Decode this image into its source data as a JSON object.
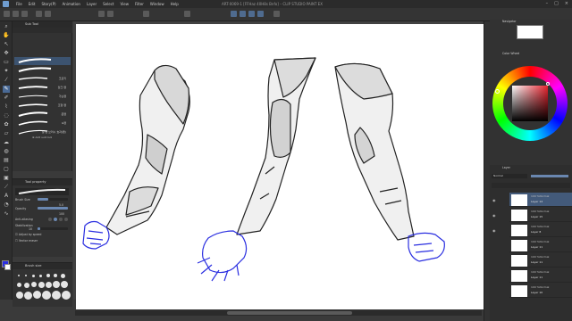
{
  "window": {
    "title": "ART-0069-1 [FFHaz 40H8s Bnfo] – CLIP STUDIO PAINT EX",
    "controls": [
      "–",
      "□",
      "×"
    ]
  },
  "menu": [
    "File",
    "Edit",
    "Story(P)",
    "Animation",
    "Layer",
    "Select",
    "View",
    "Filter",
    "Window",
    "Help"
  ],
  "subtool_panel": {
    "tab_label": "Sub Tool",
    "brushes": [
      {
        "label": ""
      },
      {
        "label": ""
      },
      {
        "label": "크로키"
      },
      {
        "label": "잉크 펜"
      },
      {
        "label": "가는펜"
      },
      {
        "label": "조형 펜"
      },
      {
        "label": "붓펜"
      },
      {
        "label": "G펜"
      },
      {
        "label": "실 펜 브러시 효과(펜)"
      }
    ],
    "add_subtool": "Add sub tool"
  },
  "tool_property": {
    "tab_label": "Tool property",
    "brush_size_label": "Brush Size",
    "brush_size_value": "5.0",
    "opacity_label": "Opacity",
    "opacity_value": "100",
    "anti_aliasing_label": "Anti-aliasing",
    "stabilization_label": "Stabilization",
    "stabilization_value": "10",
    "vector_magnet_label": "Adjust by speed",
    "vector_label": "Vector eraser"
  },
  "brush_size_panel": {
    "tab_label": "Brush size"
  },
  "navigator": {
    "tab_label": "Navigator"
  },
  "color_wheel": {
    "tab_label": "Color Wheel",
    "hue_hex": "#e8242f"
  },
  "layer_panel": {
    "tab_label": "Layer",
    "blend_mode": "Normal",
    "layers": [
      {
        "pct": "100 %Normal",
        "name": "Layer 14",
        "selected": true
      },
      {
        "pct": "100 %Normal",
        "name": "Layer 15",
        "selected": false
      },
      {
        "pct": "100 %Normal",
        "name": "Layer 8",
        "selected": false
      },
      {
        "pct": "100 %Normal",
        "name": "Layer 11",
        "selected": false
      },
      {
        "pct": "100 %Normal",
        "name": "Layer 11",
        "selected": false
      },
      {
        "pct": "100 %Normal",
        "name": "Layer 11",
        "selected": false
      },
      {
        "pct": "100 %Normal",
        "name": "Layer 10",
        "selected": false
      }
    ]
  },
  "colors": {
    "accent": "#4a6a96",
    "lineart_blue": "#2a2ee0",
    "panel_bg": "#323232"
  }
}
